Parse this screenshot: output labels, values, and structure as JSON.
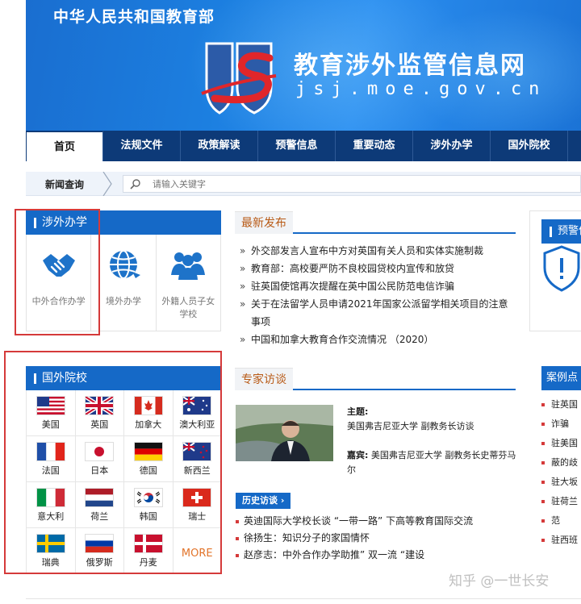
{
  "header": {
    "ministry": "中华人民共和国教育部",
    "site_title": "教育涉外监管信息网",
    "site_domain": "jsj.moe.gov.cn"
  },
  "nav": {
    "items": [
      "首页",
      "法规文件",
      "政策解读",
      "预警信息",
      "重要动态",
      "涉外办学",
      "国外院校"
    ],
    "active": "首页"
  },
  "search": {
    "label": "新闻查询",
    "placeholder": "请输入关键字"
  },
  "coop": {
    "title": "涉外办学",
    "items": [
      {
        "label": "中外合作办学",
        "icon": "handshake-icon"
      },
      {
        "label": "境外办学",
        "icon": "globe-icon"
      },
      {
        "label": "外籍人员子女学校",
        "icon": "group-icon"
      }
    ]
  },
  "foreign": {
    "title": "国外院校",
    "countries": [
      "美国",
      "英国",
      "加拿大",
      "澳大利亚",
      "法国",
      "日本",
      "德国",
      "新西兰",
      "意大利",
      "荷兰",
      "韩国",
      "瑞士",
      "瑞典",
      "俄罗斯",
      "丹麦"
    ],
    "more": "MORE"
  },
  "latest": {
    "title": "最新发布",
    "items": [
      "外交部发言人宣布中方对英国有关人员和实体实施制裁",
      "教育部：高校要严防不良校园贷校内宣传和放贷",
      "驻英国使馆再次提醒在英中国公民防范电信诈骗",
      "关于在法留学人员申请2021年国家公派留学相关项目的注意事项",
      "中国和加拿大教育合作交流情况 （2020）"
    ]
  },
  "expert": {
    "title": "专家访谈",
    "topic_key": "主题:",
    "topic": "美国弗吉尼亚大学 副教务长访谈",
    "guest_key": "嘉宾:",
    "guest": "美国弗吉尼亚大学 副教务长史蒂芬马尔",
    "history_label": "历史访谈",
    "history": [
      "英迪国际大学校长谈 “一带一路” 下高等教育国际交流",
      "徐扬生：知识分子的家国情怀",
      "赵彦志：中外合作办学助推” 双一流 “建设"
    ]
  },
  "warn": {
    "title": "预警信"
  },
  "cases": {
    "title": "案例点",
    "items": [
      "驻英国",
      "诈骗",
      "驻美国",
      "蔽的歧",
      "驻大坂",
      "驻荷兰",
      "范",
      "驻西班"
    ]
  },
  "watermark": "知乎 @一世长安",
  "colors": {
    "nav_bg": "#0d3a78",
    "panel_blue": "#1569c7",
    "accent_orange": "#b85a16",
    "annotation_red": "#d53a3a"
  }
}
